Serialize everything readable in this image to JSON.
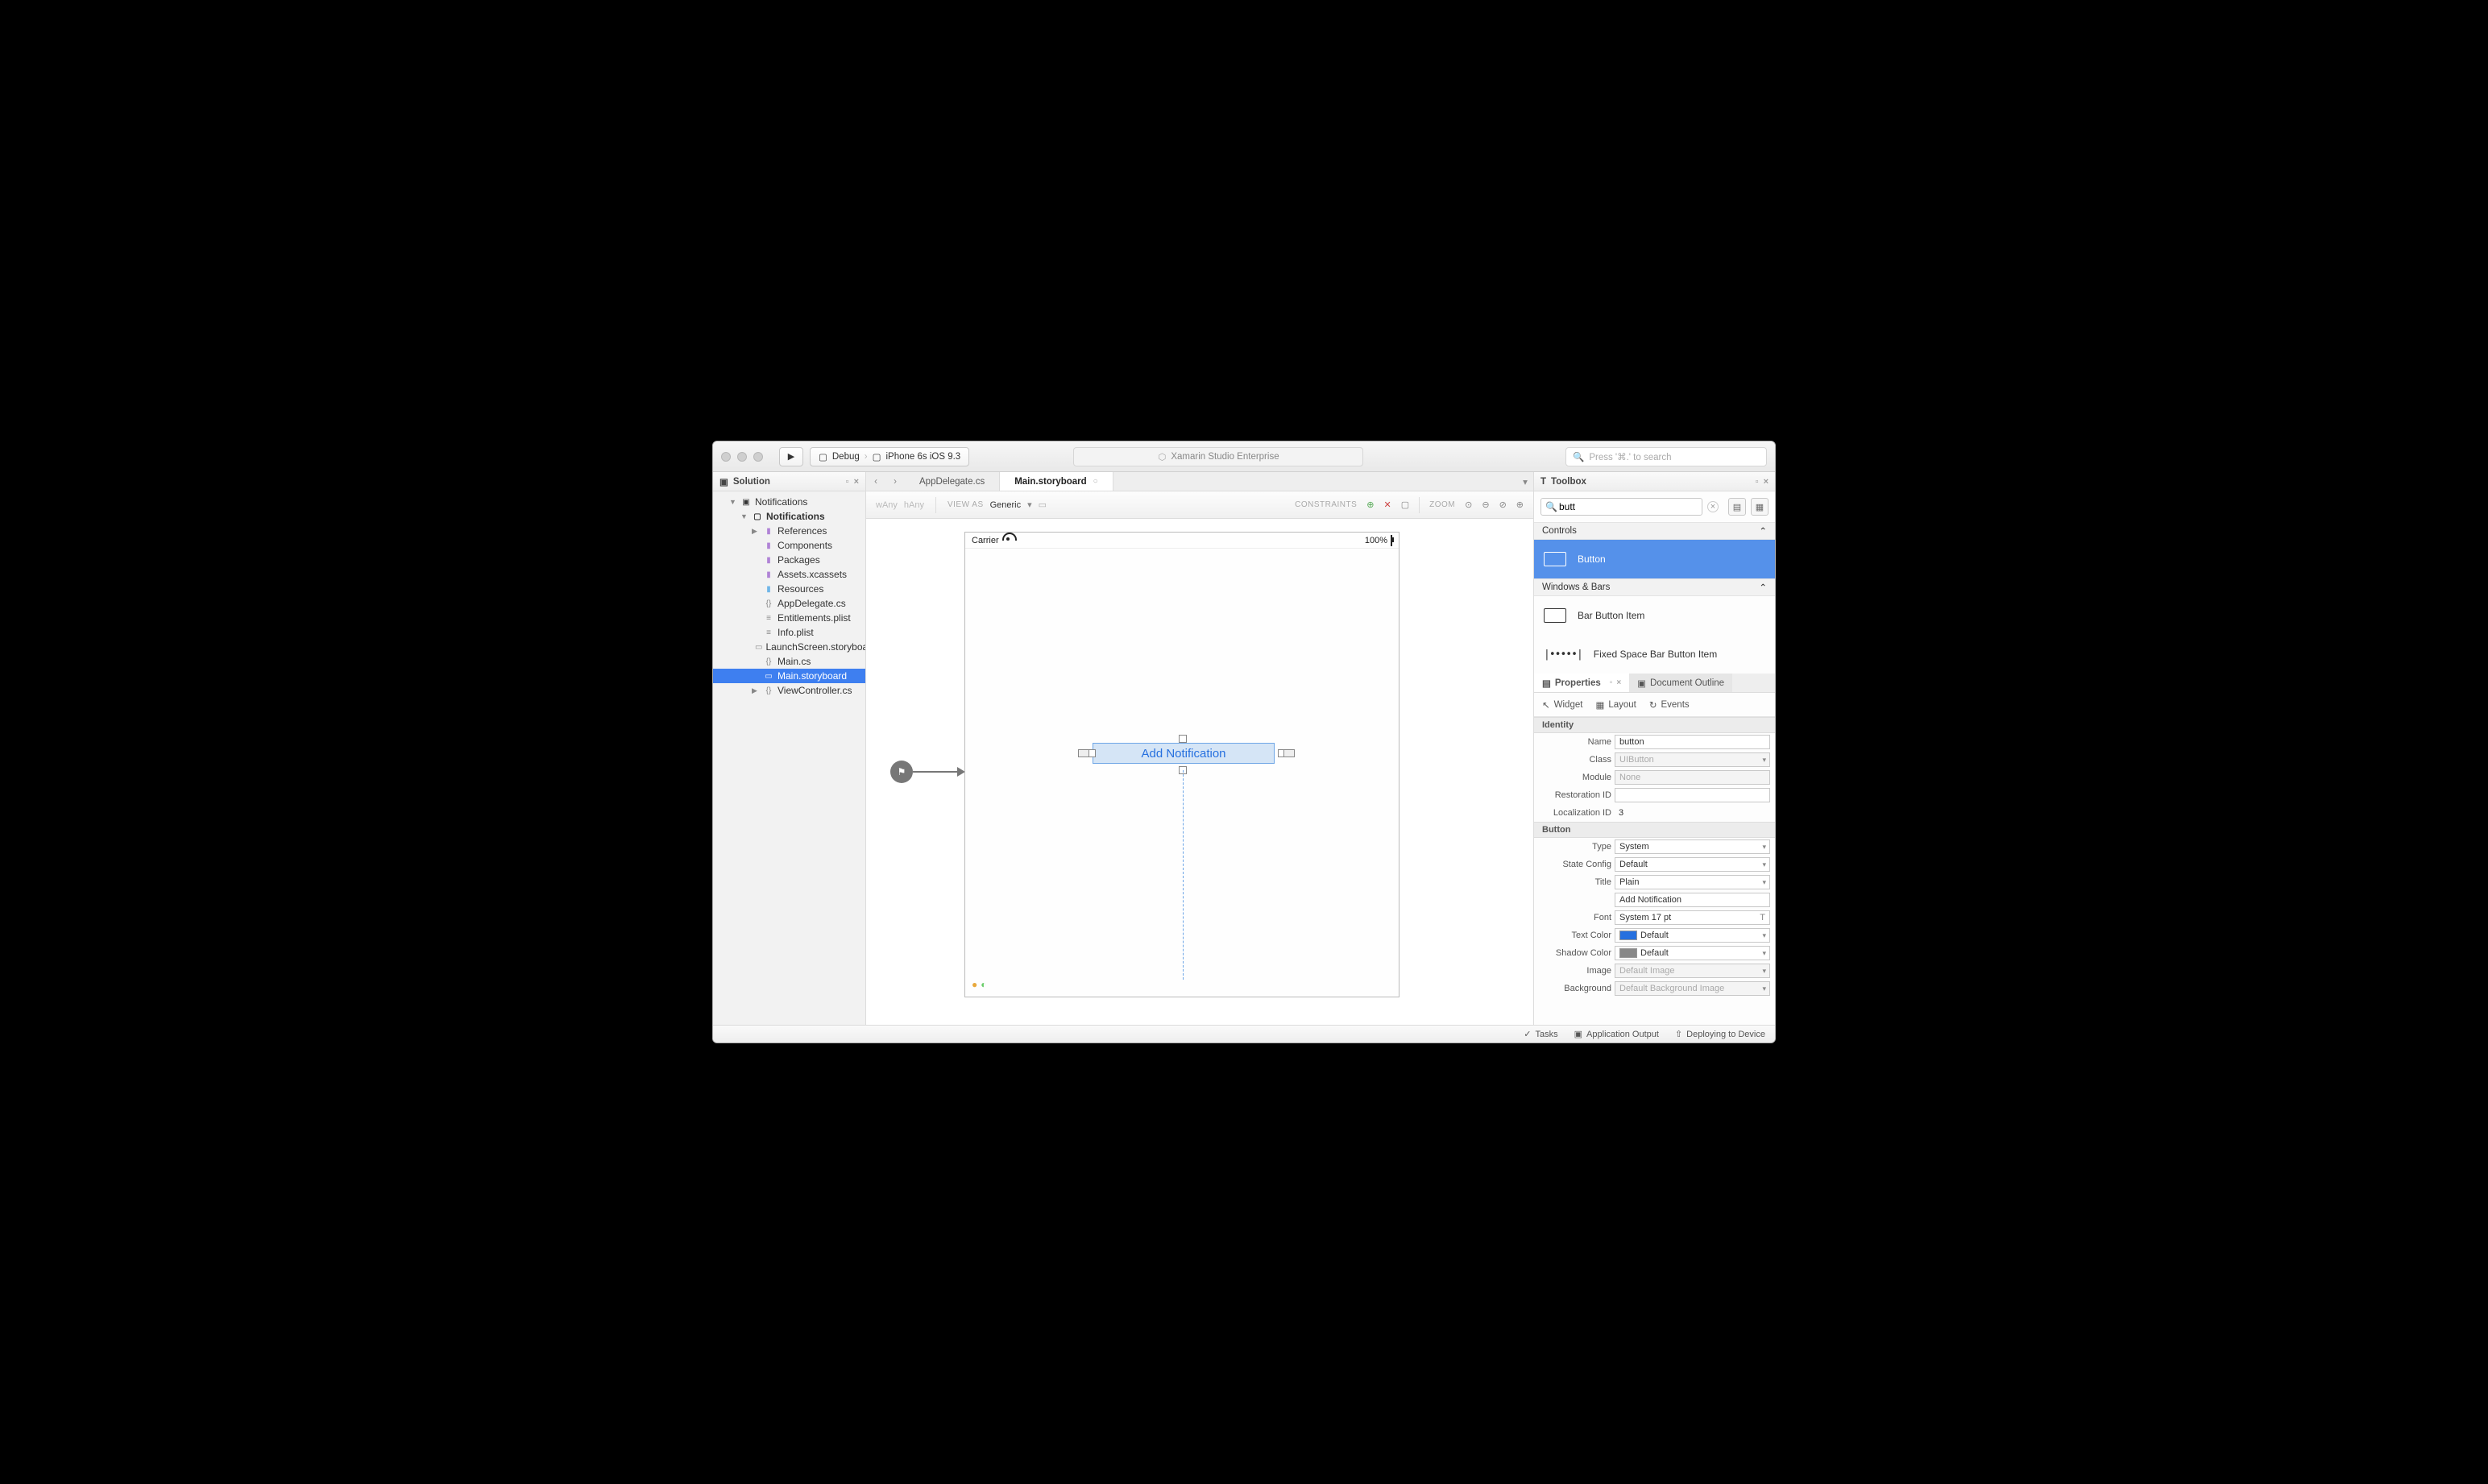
{
  "titlebar": {
    "config_left": "Debug",
    "config_right": "iPhone 6s iOS 9.3",
    "center": "Xamarin Studio Enterprise",
    "search_placeholder": "Press '⌘.' to search"
  },
  "solution": {
    "header": "Solution",
    "root": "Notifications",
    "project": "Notifications",
    "items": {
      "references": "References",
      "components": "Components",
      "packages": "Packages",
      "assets": "Assets.xcassets",
      "resources": "Resources",
      "appdelegate": "AppDelegate.cs",
      "entitlements": "Entitlements.plist",
      "infoplist": "Info.plist",
      "launchscreen": "LaunchScreen.storyboard",
      "maincs": "Main.cs",
      "mainstory": "Main.storyboard",
      "viewcontroller": "ViewController.cs"
    }
  },
  "tabs": {
    "t1": "AppDelegate.cs",
    "t2": "Main.storyboard"
  },
  "designer": {
    "wany": "wAny",
    "hany": "hAny",
    "viewas_label": "VIEW AS",
    "viewas_value": "Generic",
    "constraints_label": "CONSTRAINTS",
    "zoom_label": "ZOOM",
    "carrier": "Carrier",
    "battery_pct": "100%",
    "button_text": "Add Notification"
  },
  "toolbox": {
    "header": "Toolbox",
    "search": "butt",
    "cat_controls": "Controls",
    "cat_windows": "Windows & Bars",
    "item_button": "Button",
    "item_barbutton": "Bar Button Item",
    "item_fixedspace": "Fixed Space Bar Button Item"
  },
  "props": {
    "tab_properties": "Properties",
    "tab_outline": "Document Outline",
    "sub_widget": "Widget",
    "sub_layout": "Layout",
    "sub_events": "Events",
    "sec_identity": "Identity",
    "sec_button": "Button",
    "lbl_name": "Name",
    "val_name": "button",
    "lbl_class": "Class",
    "val_class": "UIButton",
    "lbl_module": "Module",
    "val_module": "None",
    "lbl_restoration": "Restoration ID",
    "lbl_localization": "Localization ID",
    "val_localization": "3",
    "lbl_type": "Type",
    "val_type": "System",
    "lbl_stateconfig": "State Config",
    "val_stateconfig": "Default",
    "lbl_title": "Title",
    "val_title_dd": "Plain",
    "val_title_text": "Add Notification",
    "lbl_font": "Font",
    "val_font": "System 17 pt",
    "lbl_textcolor": "Text Color",
    "val_textcolor": "Default",
    "lbl_shadowcolor": "Shadow Color",
    "val_shadowcolor": "Default",
    "lbl_image": "Image",
    "val_image": "Default Image",
    "lbl_background": "Background",
    "val_background": "Default Background Image"
  },
  "footer": {
    "tasks": "Tasks",
    "appout": "Application Output",
    "deploy": "Deploying to Device"
  }
}
